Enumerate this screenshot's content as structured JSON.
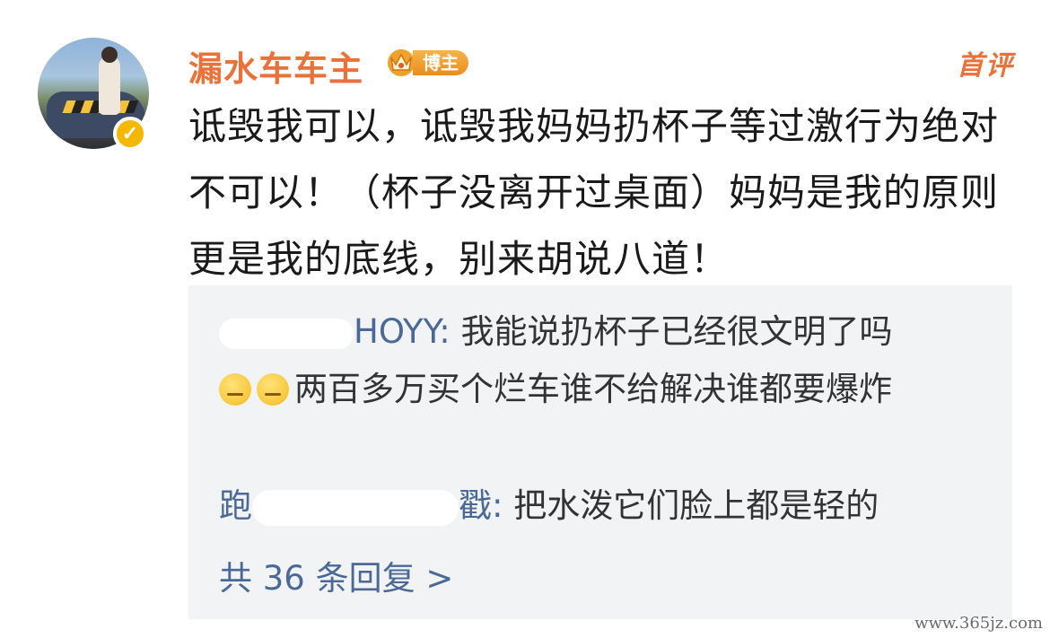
{
  "post": {
    "username": "漏水车车主",
    "badge_label": "博主",
    "first_comment_label": "首评",
    "text": "诋毁我可以，诋毁我妈妈扔杯子等过激行为绝对不可以！（杯子没离开过桌面）妈妈是我的原则更是我的底线，别来胡说八道！"
  },
  "replies": [
    {
      "name_visible": "HOYY",
      "text": "我能说扔杯子已经很文明了吗",
      "continuation": "两百多万买个烂车谁不给解决谁都要爆炸",
      "emojis": [
        "smirk-emoji",
        "smirk-emoji"
      ]
    },
    {
      "name_visible": "跑",
      "name_tail": "戳",
      "text": "把水泼它们脸上都是轻的"
    }
  ],
  "more_replies_label": "共 36 条回复 >",
  "watermark": "www.365jz.com",
  "colors": {
    "accent_orange": "#e8723a",
    "link_blue": "#4a6996",
    "reply_bg": "#f2f3f5",
    "verified_gold": "#f5b800"
  }
}
